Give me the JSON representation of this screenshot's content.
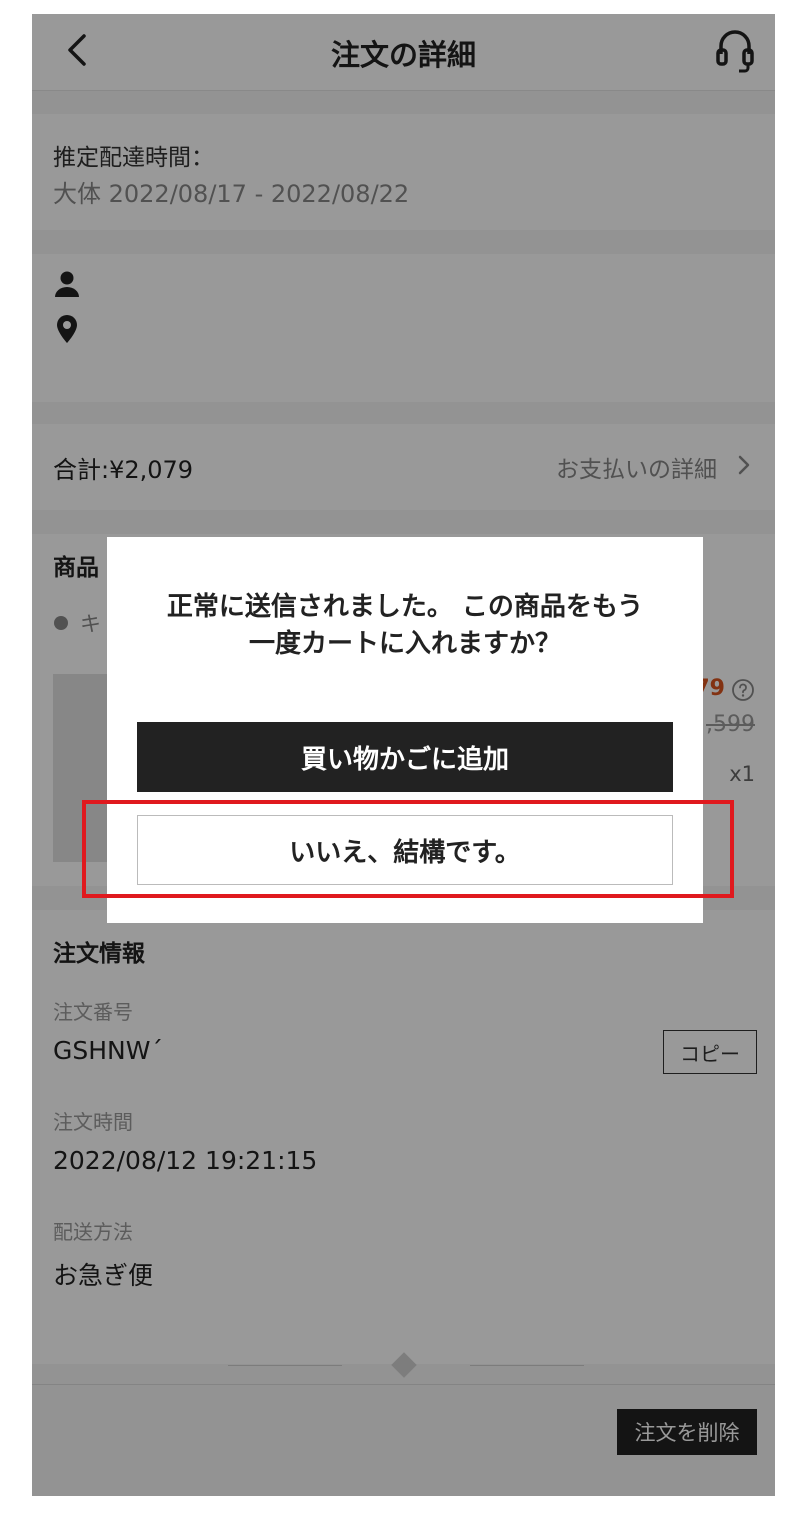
{
  "header": {
    "title": "注文の詳細"
  },
  "delivery": {
    "label": "推定配達時間：",
    "range": "大体 2022/08/17 - 2022/08/22"
  },
  "total": {
    "label": "合計:¥2,079",
    "payment_link": "お支払いの詳細"
  },
  "products": {
    "heading": "商品",
    "status": "キ",
    "price": "79",
    "original_price": ",599",
    "quantity": "x1"
  },
  "order_info": {
    "heading": "注文情報",
    "order_number_label": "注文番号",
    "order_number": "GSHNW´",
    "copy_label": "コピー",
    "order_time_label": "注文時間",
    "order_time": "2022/08/12 19:21:15",
    "shipping_label": "配送方法",
    "shipping_method": "お急ぎ便"
  },
  "footer": {
    "delete_label": "注文を削除"
  },
  "dialog": {
    "message_line1": "正常に送信されました。 この商品をもう",
    "message_line2": "一度カートに入れますか？",
    "add_to_cart_label": "買い物かごに追加",
    "decline_label": "いいえ、結構です。"
  },
  "colors": {
    "accent_price": "#d9541e",
    "highlight": "#e0191e",
    "primary_button": "#222222"
  },
  "icons": [
    "back-icon",
    "headset-icon",
    "person-icon",
    "location-pin-icon",
    "chevron-right-icon",
    "help-circle-icon"
  ]
}
